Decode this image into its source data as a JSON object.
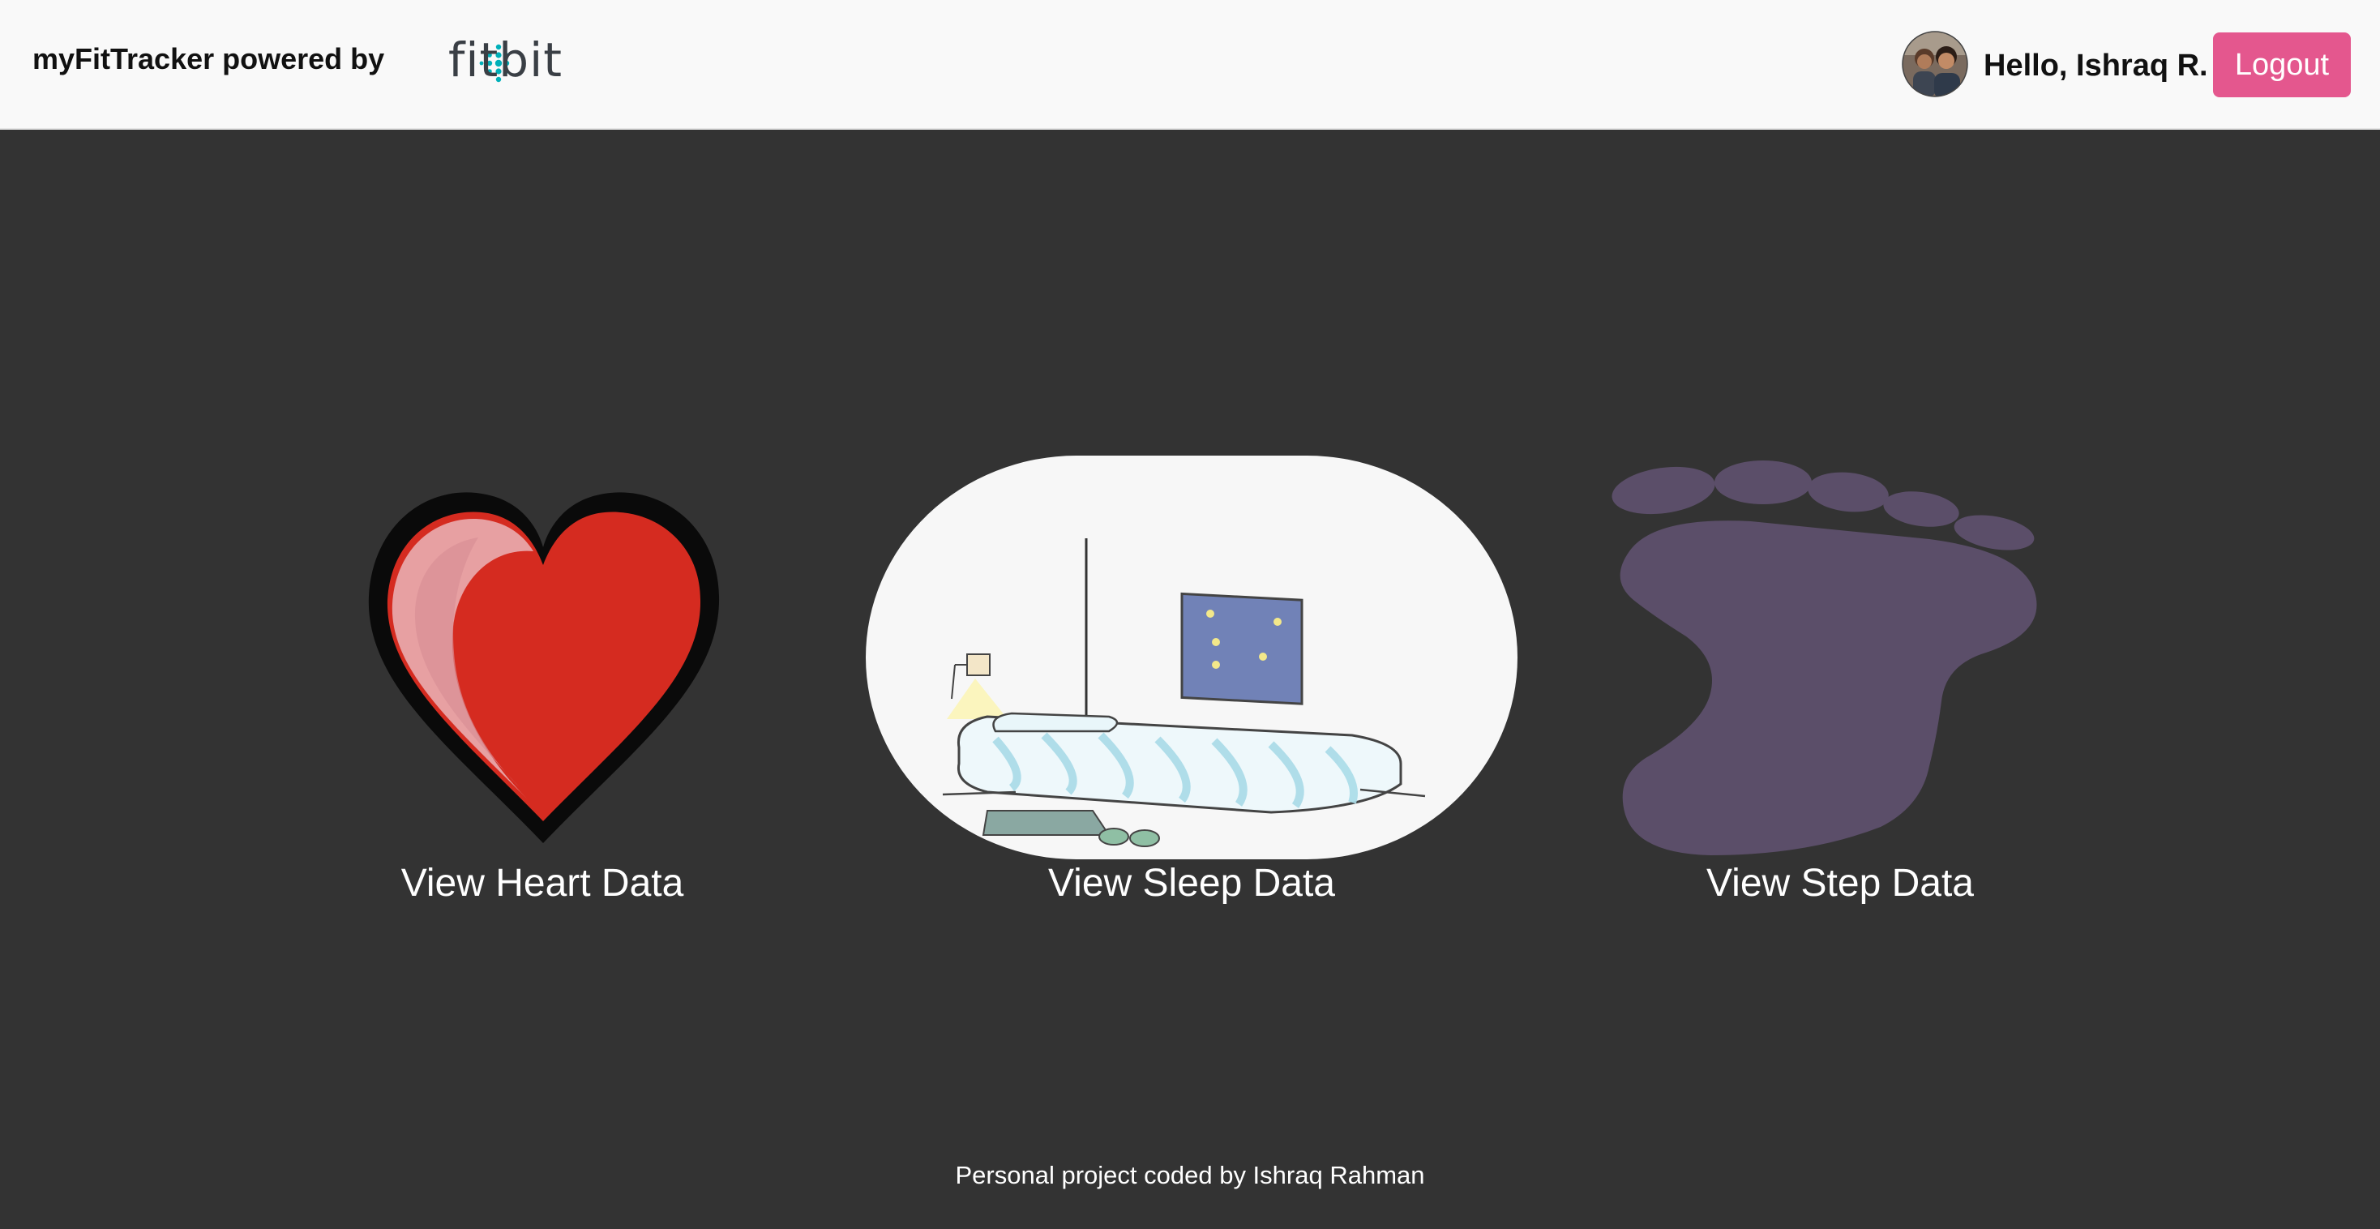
{
  "header": {
    "brand": "myFitTracker powered by",
    "logo_text": "fitbit",
    "logo_icon": "fitbit-dots-logo",
    "greeting": "Hello, Ishraq R.",
    "logout_label": "Logout",
    "avatar_icon": "user-avatar"
  },
  "cards": [
    {
      "label": "View Heart Data",
      "icon": "heart-icon"
    },
    {
      "label": "View Sleep Data",
      "icon": "bed-icon"
    },
    {
      "label": "View Step Data",
      "icon": "footprint-icon"
    }
  ],
  "footer": {
    "text": "Personal project coded by Ishraq Rahman"
  },
  "colors": {
    "header_bg": "#f9f9f9",
    "page_bg": "#333333",
    "logout_bg": "#e4578e",
    "heart_red": "#d52b20",
    "foot_purple": "#5b4e69",
    "logo_teal": "#00b0b9"
  }
}
